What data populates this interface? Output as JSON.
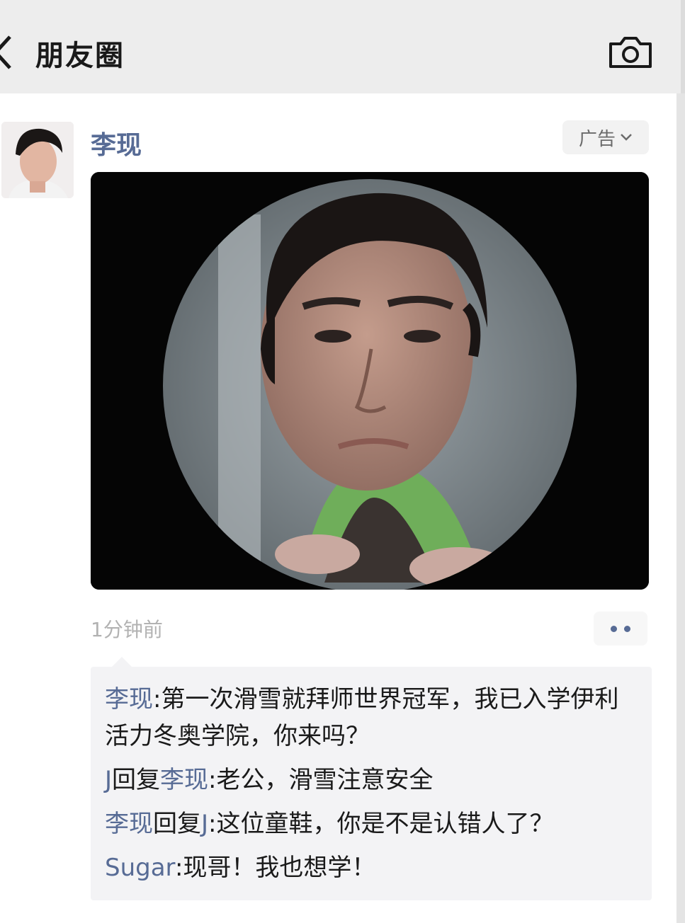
{
  "nav": {
    "title": "朋友圈",
    "back_icon": "chevron-left-icon",
    "camera_icon": "camera-icon"
  },
  "post": {
    "author": "李现",
    "ad_label": "广告",
    "time": "1分钟前",
    "media_icon": "video-portrait",
    "more_icon": "two-dots-icon"
  },
  "comments": [
    {
      "author": "李现",
      "reply_word": "",
      "reply_to": "",
      "sep": ":",
      "text": "第一次滑雪就拜师世界冠军，我已入学伊利活力冬奥学院，你来吗？"
    },
    {
      "author": "J",
      "reply_word": "回复",
      "reply_to": "李现",
      "sep": ":",
      "text": "老公，滑雪注意安全"
    },
    {
      "author": "李现",
      "reply_word": "回复",
      "reply_to": "J",
      "sep": ":",
      "text": "这位童鞋，你是不是认错人了？"
    },
    {
      "author": "Sugar",
      "reply_word": "",
      "reply_to": "",
      "sep": ":",
      "text": "现哥！我也想学！"
    }
  ],
  "colors": {
    "link": "#576b95",
    "nav_bg": "#ededed",
    "comment_bg": "#f3f3f5",
    "time": "#b2b2b2"
  }
}
